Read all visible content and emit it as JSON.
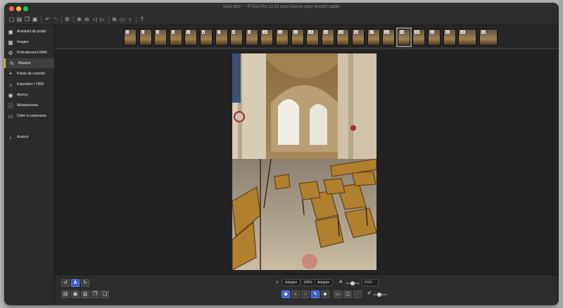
{
  "window": {
    "title": "Sans titre * - PTGui Pro 13.10 sous licence pour vincent sabler",
    "traffic_colors": [
      "#ff5f57",
      "#febc2e",
      "#28c840"
    ]
  },
  "toolbar": {
    "icons": [
      "new-project-icon",
      "open-icon",
      "copy-icon",
      "save-icon",
      "undo-icon",
      "redo-icon",
      "settings-icon",
      "zoom-in-icon",
      "zoom-out-icon",
      "prev-icon",
      "next-icon",
      "crop-icon",
      "panorama-view-icon",
      "marker-icon",
      "help-icon"
    ]
  },
  "sidebar": {
    "items": [
      {
        "label": "Assistant de projet",
        "icon": "wizard-icon",
        "glyph": "▣"
      },
      {
        "label": "Images",
        "icon": "images-icon",
        "glyph": "▦"
      },
      {
        "label": "Prétraitement RAW",
        "icon": "raw-icon",
        "glyph": "⚙"
      },
      {
        "label": "Masque",
        "icon": "brush-icon",
        "glyph": "✎",
        "active": true
      },
      {
        "label": "Points de contrôle",
        "icon": "control-points-icon",
        "glyph": "⌖"
      },
      {
        "label": "Exposition / HDR",
        "icon": "sun-icon",
        "glyph": "☼"
      },
      {
        "label": "Aperçu",
        "icon": "eye-icon",
        "glyph": "◉"
      },
      {
        "label": "Métadonnées",
        "icon": "info-icon",
        "glyph": "ⓘ"
      },
      {
        "label": "Créer le panorama",
        "icon": "panorama-icon",
        "glyph": "▭"
      },
      {
        "label": "Avancé",
        "icon": "chevron-icon",
        "glyph": "›"
      }
    ]
  },
  "thumbnails": {
    "numbers": [
      "1",
      "2",
      "3",
      "4",
      "5",
      "6",
      "7",
      "8",
      "9",
      "10",
      "11",
      "12",
      "13",
      "14",
      "15",
      "16",
      "17",
      "18",
      "19",
      "20",
      "21",
      "22",
      "23",
      "24"
    ],
    "selected_index": 18
  },
  "bottom": {
    "zoom_label": "Adapter",
    "zoom_percent": "100%",
    "zoom_fit": "Adapter",
    "exposure": "0 EV",
    "accent": "#3b5ec7"
  }
}
